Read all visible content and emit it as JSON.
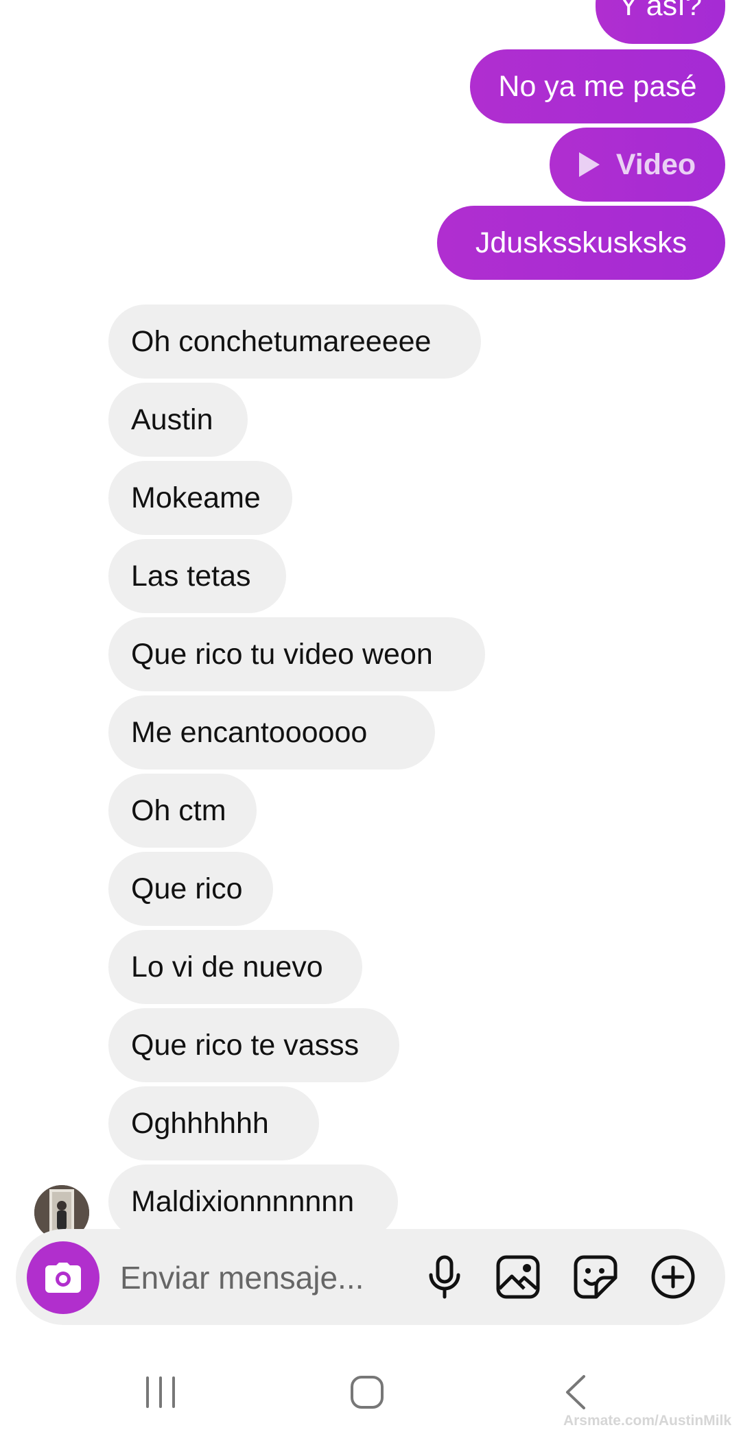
{
  "sent_messages": [
    {
      "text": "Y así?"
    },
    {
      "text": "No ya me pasé"
    },
    {
      "text": "Video",
      "type": "video"
    },
    {
      "text": "Jdusksskusksks"
    }
  ],
  "received_messages": [
    {
      "text": "Oh conchetumareeeee"
    },
    {
      "text": "Austin"
    },
    {
      "text": "Mokeame"
    },
    {
      "text": "Las tetas"
    },
    {
      "text": "Que rico tu video weon"
    },
    {
      "text": "Me encantoooooo"
    },
    {
      "text": "Oh ctm"
    },
    {
      "text": "Que rico"
    },
    {
      "text": "Lo vi de nuevo"
    },
    {
      "text": "Que rico te vasss"
    },
    {
      "text": "Oghhhhhh"
    },
    {
      "text": "Maldixionnnnnnn"
    }
  ],
  "composer": {
    "placeholder": "Enviar mensaje...",
    "icons": [
      "camera-icon",
      "microphone-icon",
      "gallery-icon",
      "sticker-icon",
      "plus-icon"
    ]
  },
  "navbar": {
    "icons": [
      "recent-apps-icon",
      "home-icon",
      "back-icon"
    ]
  },
  "watermark": "Arsmate.com/AustinMilk",
  "colors": {
    "sent_bubble": "#b02ed0",
    "received_bubble": "#efefef",
    "accent": "#b12fcd"
  }
}
